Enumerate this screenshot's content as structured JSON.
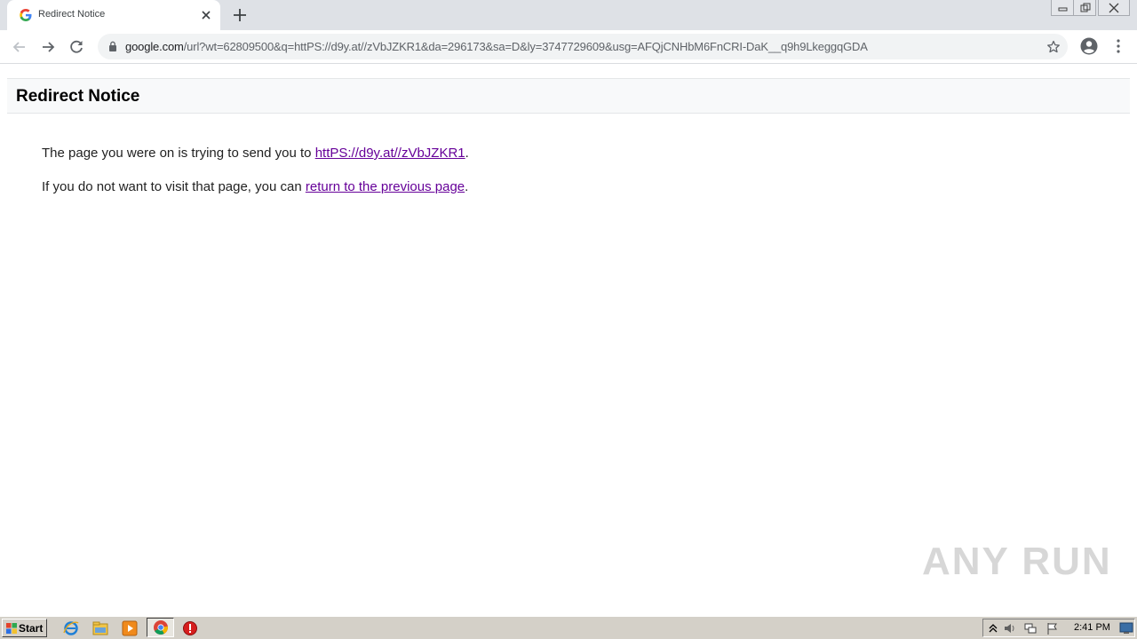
{
  "browser": {
    "tab": {
      "title": "Redirect Notice",
      "favicon": "google-g-icon"
    },
    "address": {
      "host": "google.com",
      "path": "/url?wt=62809500&q=httPS://d9y.at//zVbJZKR1&da=296173&sa=D&ly=3747729609&usg=AFQjCNHbM6FnCRI-DaK__q9h9LkeggqGDA"
    }
  },
  "page": {
    "title": "Redirect Notice",
    "line1_prefix": "The page you were on is trying to send you to ",
    "line1_link": "httPS://d9y.at//zVbJZKR1",
    "line1_suffix": ".",
    "line2_prefix": "If you do not want to visit that page, you can ",
    "line2_link": "return to the previous page",
    "line2_suffix": "."
  },
  "watermark": "ANY RUN",
  "taskbar": {
    "start_label": "Start",
    "clock": "2:41 PM"
  },
  "colors": {
    "link": "#660099",
    "tabstrip": "#dee1e6",
    "taskbar": "#d4d0c8"
  }
}
